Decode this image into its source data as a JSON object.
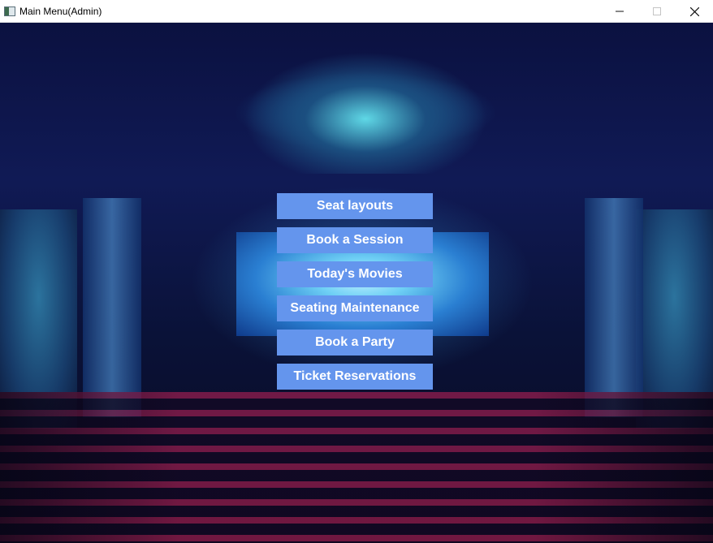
{
  "window": {
    "title": "Main Menu(Admin)",
    "controls": {
      "minimize": "—",
      "maximize": "☐",
      "close": "✕"
    }
  },
  "menu": {
    "button_color": "#6495ed",
    "items": [
      {
        "label": "Seat layouts"
      },
      {
        "label": "Book a Session"
      },
      {
        "label": "Today's Movies"
      },
      {
        "label": "Seating Maintenance"
      },
      {
        "label": "Book a Party"
      },
      {
        "label": "Ticket Reservations"
      }
    ]
  }
}
